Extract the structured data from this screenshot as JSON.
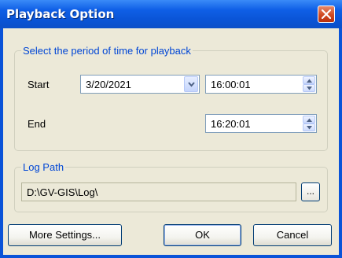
{
  "window": {
    "title": "Playback Option"
  },
  "period_group": {
    "legend": "Select the period of time for playback",
    "start_label": "Start",
    "start_date": "3/20/2021",
    "start_time": "16:00:01",
    "end_label": "End",
    "end_time": "16:20:01"
  },
  "log_group": {
    "legend": "Log Path",
    "path": "D:\\GV-GIS\\Log\\",
    "browse_label": "..."
  },
  "buttons": {
    "more_settings": "More Settings...",
    "ok": "OK",
    "cancel": "Cancel"
  },
  "colors": {
    "titlebar": "#0a54d6",
    "legend_text": "#0046d5",
    "dialog_bg": "#ece9d8",
    "close_button": "#d04a22"
  },
  "icons": [
    "close-icon",
    "chevron-down-icon",
    "arrow-up-icon",
    "arrow-down-icon"
  ]
}
